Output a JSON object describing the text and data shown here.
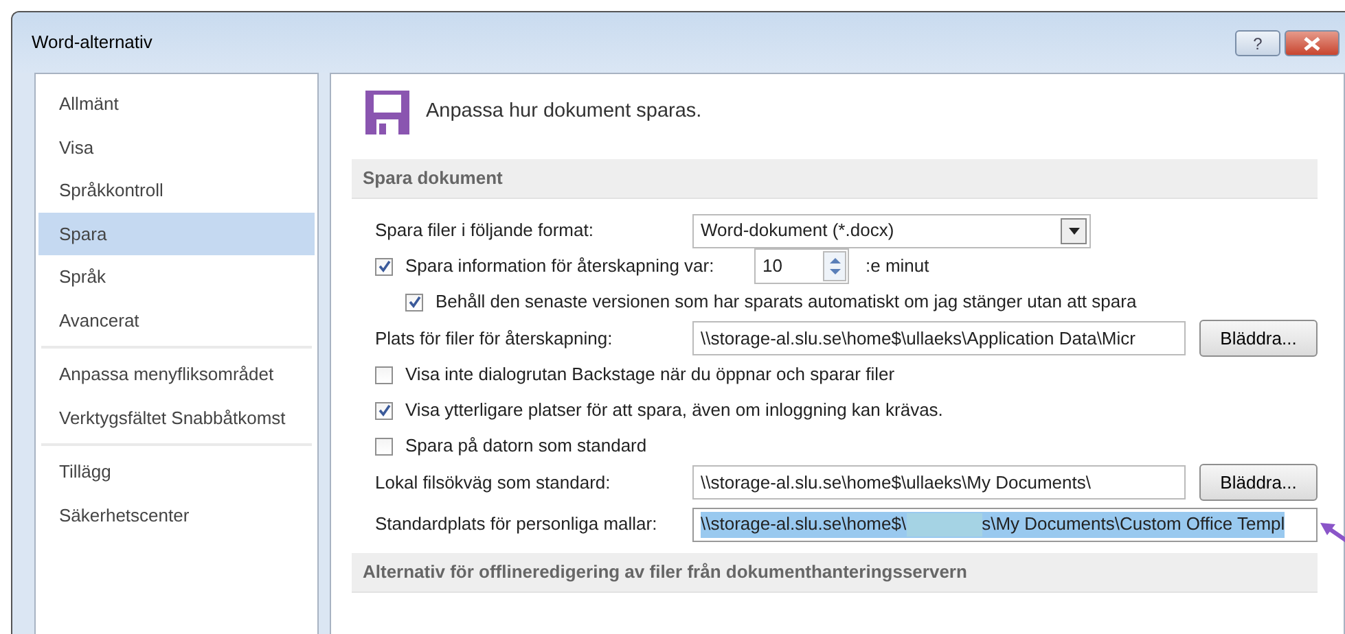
{
  "window": {
    "title": "Word-alternativ"
  },
  "title_buttons": [
    {
      "kind": "help",
      "text": "?"
    },
    {
      "kind": "close"
    }
  ],
  "sidebar": {
    "groups": [
      {
        "items": [
          {
            "label": "Allmänt",
            "selected": false
          },
          {
            "label": "Visa",
            "selected": false
          },
          {
            "label": "Språkkontroll",
            "selected": false
          },
          {
            "label": "Spara",
            "selected": true
          },
          {
            "label": "Språk",
            "selected": false
          },
          {
            "label": "Avancerat",
            "selected": false
          }
        ]
      },
      {
        "items": [
          {
            "label": "Anpassa menyfliksområdet",
            "selected": false
          },
          {
            "label": "Verktygsfältet Snabbåtkomst",
            "selected": false
          }
        ]
      },
      {
        "items": [
          {
            "label": "Tillägg",
            "selected": false
          },
          {
            "label": "Säkerhetscenter",
            "selected": false
          }
        ]
      }
    ]
  },
  "header": {
    "title": "Anpassa hur dokument sparas."
  },
  "sections": [
    {
      "title": "Spara dokument",
      "rows": [
        {
          "kind": "select",
          "label": "Spara filer i följande format:",
          "value": "Word-dokument (*.docx)"
        },
        {
          "kind": "checkbox_spin",
          "label": "Spara information för återskapning var:",
          "checked": true,
          "value": "10",
          "suffix": ":e minut",
          "children": [
            {
              "kind": "checkbox",
              "label": "Behåll den senaste versionen som har sparats automatiskt om jag stänger utan att spara",
              "checked": true
            }
          ]
        },
        {
          "kind": "field_browse",
          "label": "Plats för filer för återskapning:",
          "value": "\\\\storage-al.slu.se\\home$\\ullaeks\\Application Data\\Micr",
          "button": "Bläddra..."
        },
        {
          "kind": "checkbox",
          "label": "Visa inte dialogrutan Backstage när du öppnar och sparar filer",
          "checked": false
        },
        {
          "kind": "checkbox",
          "label": "Visa ytterligare platser för att spara, även om inloggning kan krävas.",
          "checked": true
        },
        {
          "kind": "checkbox",
          "label": "Spara på datorn som standard",
          "checked": false
        },
        {
          "kind": "field_browse",
          "label": "Lokal filsökväg som standard:",
          "value": "\\\\storage-al.slu.se\\home$\\ullaeks\\My Documents\\",
          "button": "Bläddra..."
        },
        {
          "kind": "field_redacted",
          "label": "Standardplats för personliga mallar:",
          "value_parts": [
            "\\\\storage-al.slu.se\\home$\\",
            "s\\My Documents\\Custom Office Templ"
          ],
          "selected": true,
          "pointer_arrow": true
        }
      ]
    },
    {
      "title": "Alternativ för offlineredigering av filer från dokumenthanteringsservern"
    }
  ]
}
